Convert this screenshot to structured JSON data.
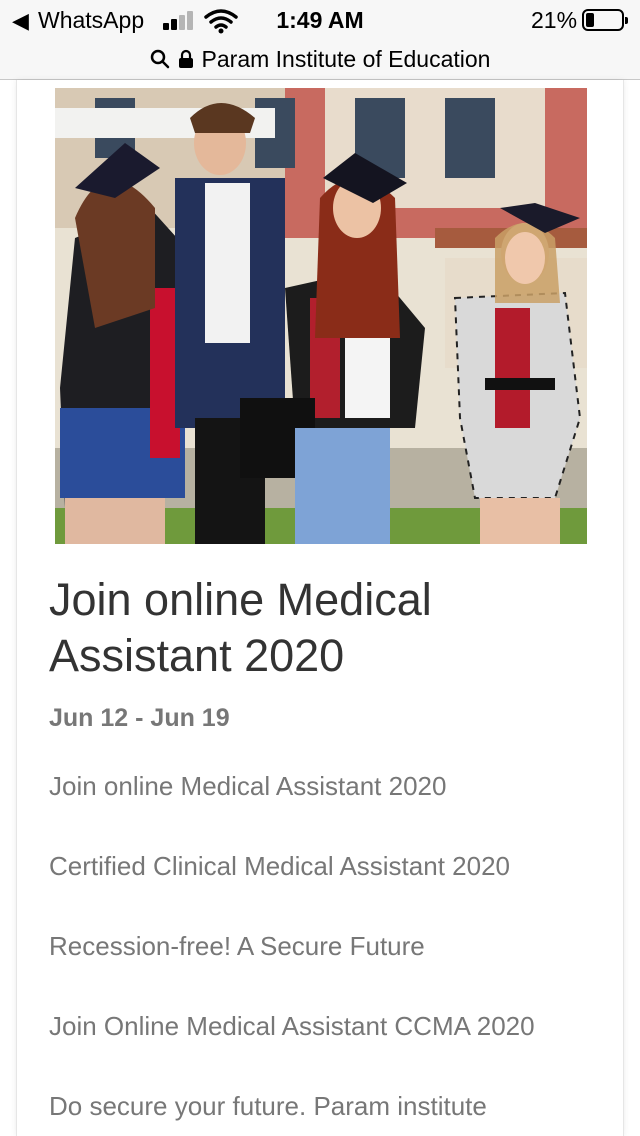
{
  "status_bar": {
    "back_app": "WhatsApp",
    "time": "1:49 AM",
    "battery_percent": "21%",
    "battery_level": 0.21,
    "signal_bars": 2,
    "icons": [
      "back-arrow-icon",
      "signal-icon",
      "wifi-icon",
      "battery-icon"
    ]
  },
  "address_bar": {
    "title": "Param Institute of Education",
    "icons": [
      "search-icon",
      "lock-icon"
    ]
  },
  "event": {
    "image_alt": "Students in graduation caps walking outdoors",
    "title": "Join online Medical Assistant 2020",
    "dates": "Jun 12 - Jun 19",
    "description_lines": [
      "Join online Medical Assistant 2020",
      "Certified Clinical Medical Assistant 2020",
      "Recession-free! A Secure Future",
      "Join Online Medical Assistant CCMA 2020",
      "Do secure your future. Param institute"
    ]
  },
  "colors": {
    "status_bg": "#f7f7f7",
    "heading_text": "#333333",
    "body_text": "#777777",
    "accent_red": "#c8102e"
  }
}
